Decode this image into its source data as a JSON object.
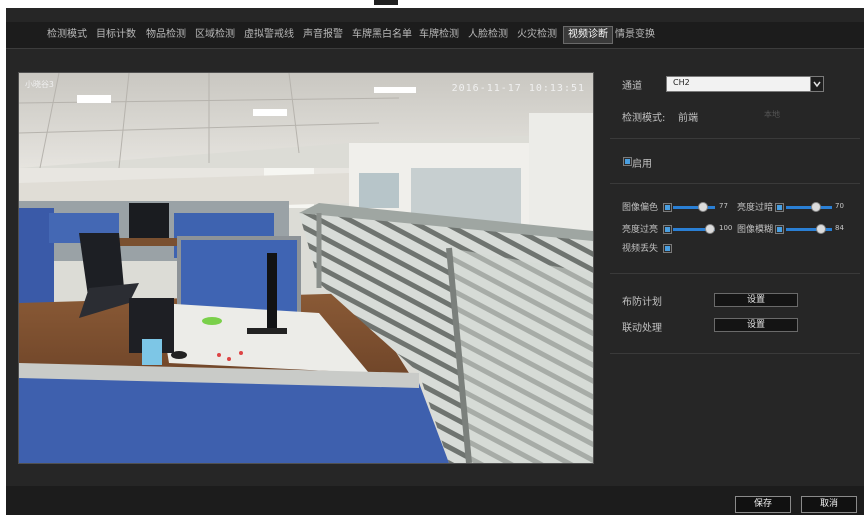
{
  "tabs": [
    {
      "label": "检测模式",
      "active": false
    },
    {
      "label": "目标计数",
      "active": false
    },
    {
      "label": "物品检测",
      "active": false
    },
    {
      "label": "区域检测",
      "active": false
    },
    {
      "label": "虚拟警戒线",
      "active": false
    },
    {
      "label": "声音报警",
      "active": false
    },
    {
      "label": "车牌黑白名单",
      "active": false
    },
    {
      "label": "车牌检测",
      "active": false
    },
    {
      "label": "人脸检测",
      "active": false
    },
    {
      "label": "火灾检测",
      "active": false
    },
    {
      "label": "视频诊断",
      "active": true
    },
    {
      "label": "情景变换",
      "active": false
    }
  ],
  "preview": {
    "camera_name": "小晓谷3",
    "timestamp": "2016-11-17 10:13:51"
  },
  "panel": {
    "channel_label": "通道",
    "channel_value": "CH2",
    "mode_label": "检测模式:",
    "mode_value": "前端",
    "mode_value_dim": "本地",
    "enable_label": "启用",
    "enable_checked": true,
    "params": [
      {
        "label": "图像偏色",
        "checked": true,
        "value": 77,
        "value_text": "77"
      },
      {
        "label": "亮度过暗",
        "checked": true,
        "value": 70,
        "value_text": "70"
      },
      {
        "label": "亮度过亮",
        "checked": true,
        "value": 100,
        "value_text": "100"
      },
      {
        "label": "图像模糊",
        "checked": true,
        "value": 84,
        "value_text": "84"
      }
    ],
    "video_loss_label": "视频丢失",
    "video_loss_checked": true,
    "schedule_label": "布防计划",
    "schedule_button": "设置",
    "linkage_label": "联动处理",
    "linkage_button": "设置"
  },
  "footer": {
    "save_label": "保存",
    "cancel_label": "取消"
  },
  "colors": {
    "accent": "#2a7fd4",
    "background": "#262626"
  }
}
